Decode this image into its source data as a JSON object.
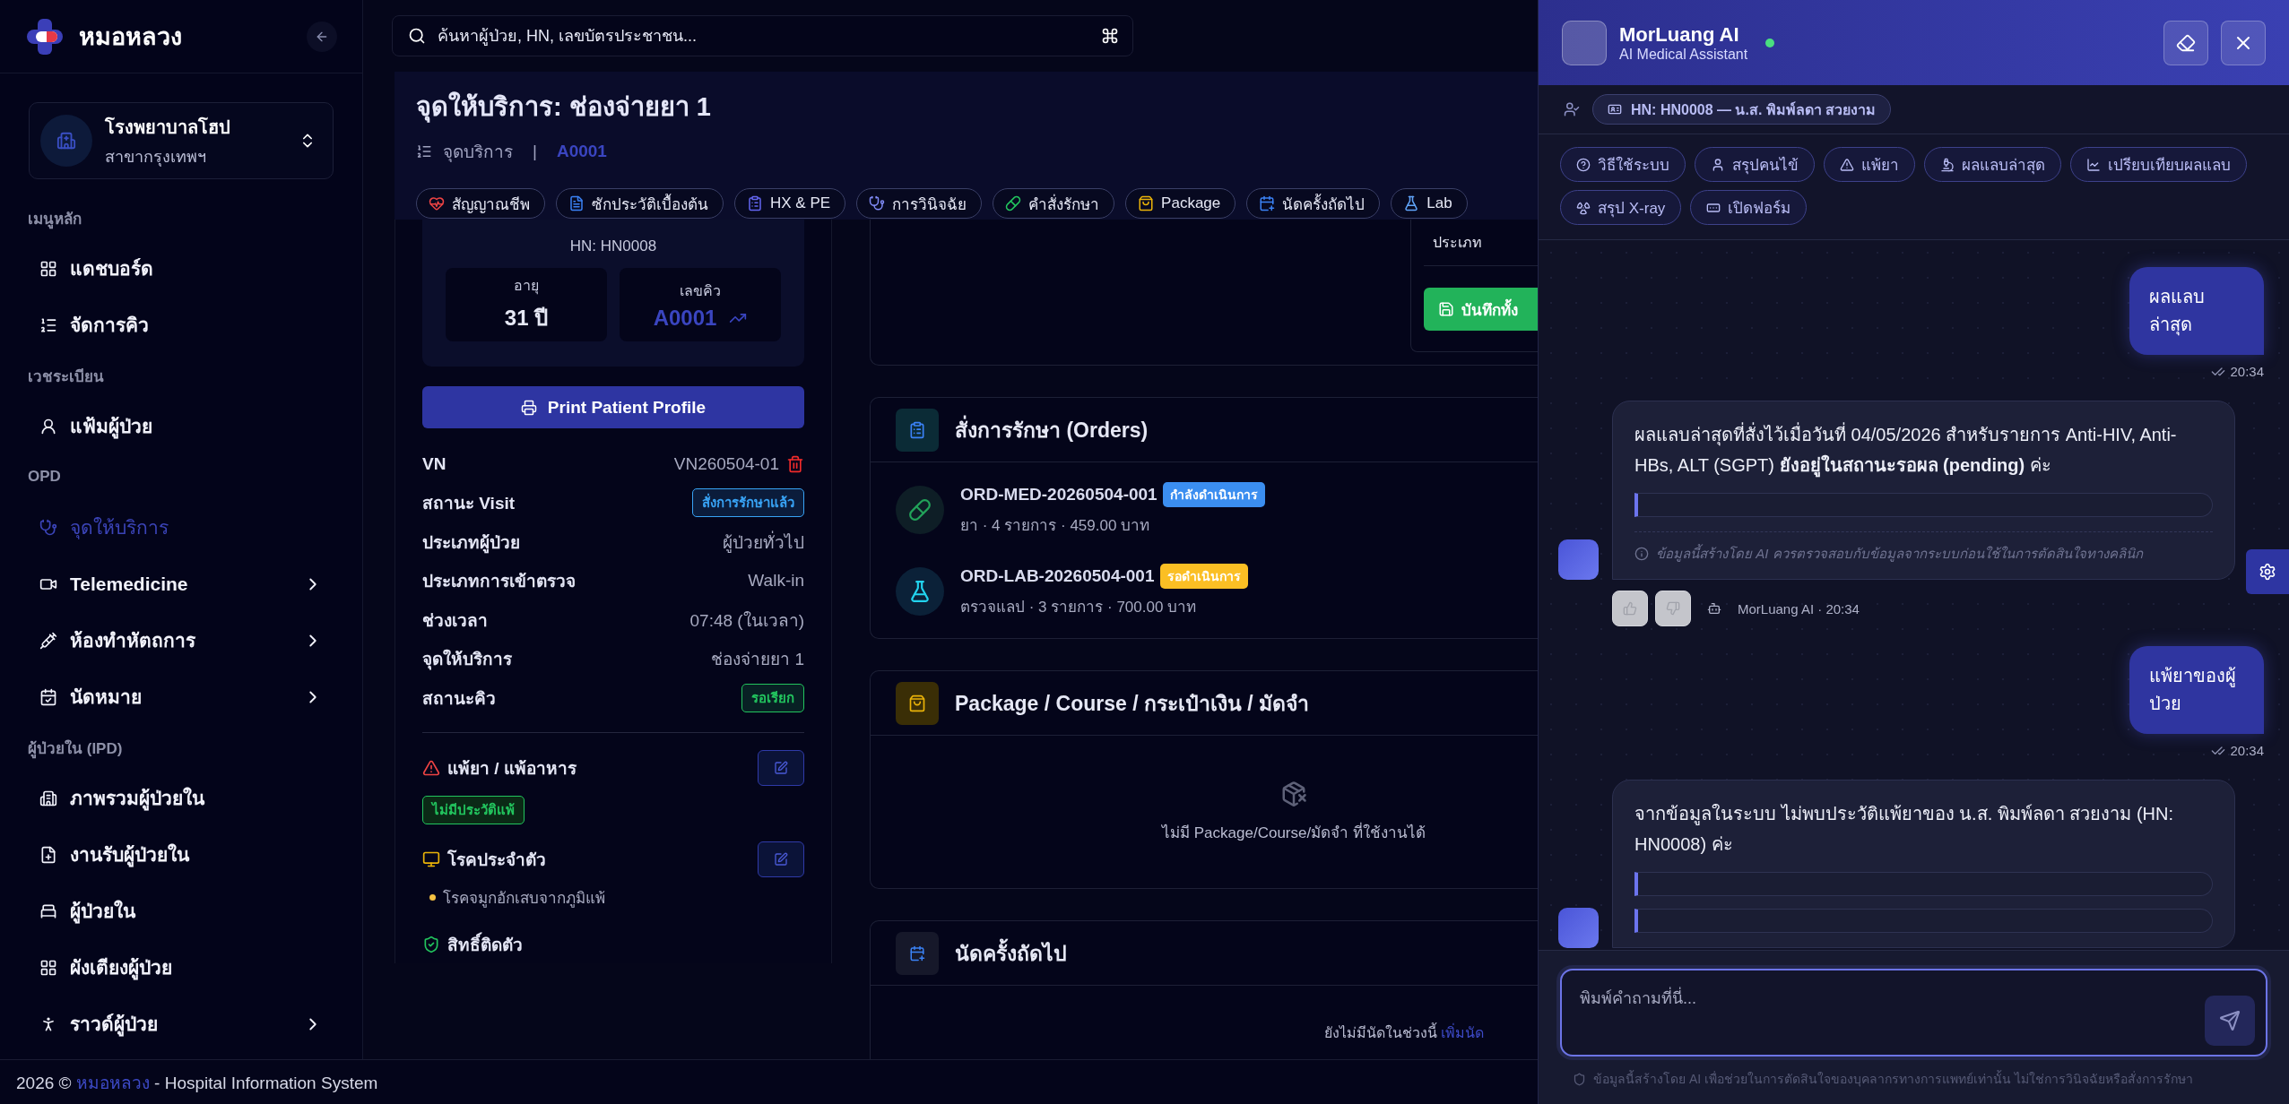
{
  "sidebar": {
    "brand": "หมอหลวง",
    "hospital": {
      "name": "โรงพยาบาลโฮป",
      "branch": "สาขากรุงเทพฯ"
    },
    "sections": [
      {
        "title": "เมนูหลัก",
        "items": [
          {
            "label": "แดชบอร์ด",
            "selected": false,
            "has_submenu": false
          },
          {
            "label": "จัดการคิว",
            "selected": false,
            "has_submenu": false
          }
        ]
      },
      {
        "title": "เวชระเบียน",
        "items": [
          {
            "label": "แฟ้มผู้ป่วย",
            "selected": false,
            "has_submenu": false
          }
        ]
      },
      {
        "title": "OPD",
        "items": [
          {
            "label": "จุดให้บริการ",
            "selected": true,
            "has_submenu": false
          },
          {
            "label": "Telemedicine",
            "selected": false,
            "has_submenu": true
          },
          {
            "label": "ห้องทำหัตถการ",
            "selected": false,
            "has_submenu": true
          },
          {
            "label": "นัดหมาย",
            "selected": false,
            "has_submenu": true
          }
        ]
      },
      {
        "title": "ผู้ป่วยใน (IPD)",
        "items": [
          {
            "label": "ภาพรวมผู้ป่วยใน",
            "selected": false,
            "has_submenu": false
          },
          {
            "label": "งานรับผู้ป่วยใน",
            "selected": false,
            "has_submenu": false
          },
          {
            "label": "ผู้ป่วยใน",
            "selected": false,
            "has_submenu": false
          },
          {
            "label": "ผังเตียงผู้ป่วย",
            "selected": false,
            "has_submenu": false
          },
          {
            "label": "ราวด์ผู้ป่วย",
            "selected": false,
            "has_submenu": true
          }
        ]
      }
    ]
  },
  "search": {
    "placeholder": "ค้นหาผู้ป่วย, HN, เลขบัตรประชาชน..."
  },
  "page_header": {
    "title": "จุดให้บริการ: ช่องจ่ายยา 1",
    "breadcrumb": "จุดบริการ",
    "separator": "|",
    "queue": "A0001",
    "tabs": [
      "สัญญาณชีพ",
      "ซักประวัติเบื้องต้น",
      "HX & PE",
      "การวินิจฉัย",
      "คำสั่งรักษา",
      "Package",
      "นัดครั้งถัดไป",
      "Lab"
    ]
  },
  "patient": {
    "hn": "HN: HN0008",
    "stats": [
      {
        "label": "อายุ",
        "value": "31 ปี",
        "highlight": false
      },
      {
        "label": "เลขคิว",
        "value": "A0001",
        "highlight": true
      }
    ],
    "print_button": "Print Patient Profile",
    "rows": [
      {
        "label": "VN",
        "value": "VN260504-01",
        "kind": "text",
        "deletable": true
      },
      {
        "label": "สถานะ Visit",
        "value": "สั่งการรักษาแล้ว",
        "kind": "badge",
        "color": "#38a3f5"
      },
      {
        "label": "ประเภทผู้ป่วย",
        "value": "ผู้ป่วยทั่วไป",
        "kind": "text",
        "deletable": false
      },
      {
        "label": "ประเภทการเข้าตรวจ",
        "value": "Walk-in",
        "kind": "text",
        "deletable": false
      },
      {
        "label": "ช่วงเวลา",
        "value": "07:48 (ในเวลา)",
        "kind": "text",
        "deletable": false
      },
      {
        "label": "จุดให้บริการ",
        "value": "ช่องจ่ายยา 1",
        "kind": "text",
        "deletable": false
      },
      {
        "label": "สถานะคิว",
        "value": "รอเรียก",
        "kind": "badge",
        "color": "#22c55e"
      }
    ],
    "allergy": {
      "title": "แพ้ยา / แพ้อาหาร",
      "badge": "ไม่มีประวัติแพ้"
    },
    "chronic": {
      "title": "โรคประจำตัว",
      "items": [
        "โรคจมูกอักเสบจากภูมิแพ้"
      ]
    },
    "rights": {
      "title": "สิทธิ์ติดตัว"
    }
  },
  "visit_panel": {
    "type_label": "ประเภท",
    "save_button": "บันทึกทั้ง"
  },
  "orders": {
    "title": "สั่งการรักษา (Orders)",
    "items": [
      {
        "kind": "med",
        "code": "ORD-MED-20260504-001",
        "status": "กำลังดำเนินการ",
        "color": "#3b8ef0",
        "detail": "ยา · 4 รายการ · 459.00 บาท"
      },
      {
        "kind": "lab",
        "code": "ORD-LAB-20260504-001",
        "status": "รอดำเนินการ",
        "color": "#fbbf24",
        "detail": "ตรวจแลป · 3 รายการ · 700.00 บาท"
      }
    ]
  },
  "package": {
    "title": "Package / Course / กระเป๋าเงิน / มัดจำ",
    "empty_text": "ไม่มี Package/Course/มัดจำ ที่ใช้งานได้"
  },
  "appointment": {
    "title": "นัดครั้งถัดไป",
    "empty_text": "ยังไม่มีนัดในช่วงนี้",
    "link": "เพิ่มนัด"
  },
  "footer": {
    "year": "2026 ©",
    "brand": "หมอหลวง",
    "rest": "- Hospital Information System"
  },
  "chat": {
    "title": "MorLuang AI",
    "subtitle": "AI Medical Assistant",
    "online": true,
    "context": "HN: HN0008 — น.ส. พิมพ์ลดา สวยงาม",
    "quick_actions": [
      "วิธีใช้ระบบ",
      "สรุปคนไข้",
      "แพ้ยา",
      "ผลแลบล่าสุด",
      "เปรียบเทียบผลแลบ",
      "สรุป X-ray",
      "เปิดฟอร์ม"
    ],
    "messages": [
      {
        "kind": "user",
        "text": "ผลแลบล่าสุด",
        "time": "20:34",
        "read": true
      },
      {
        "kind": "ai",
        "text": "ผลแลบล่าสุดที่สั่งไว้เมื่อวันที่ 04/05/2026 สำหรับรายการ Anti-HIV, Anti-HBs, ALT (SGPT) **ยังอยู่ในสถานะรอผล (pending)** ค่ะ",
        "cards": [
          {
            "kind": "placeholder"
          }
        ],
        "disclaimer": "ข้อมูลนี้สร้างโดย AI ควรตรวจสอบกับข้อมูลจากระบบก่อนใช้ในการตัดสินใจทางคลินิก",
        "meta": "MorLuang AI · 20:34"
      },
      {
        "kind": "user",
        "text": "แพ้ยาของผู้ป่วย",
        "time": "20:34",
        "read": true
      },
      {
        "kind": "ai",
        "text": "จากข้อมูลในระบบ ไม่พบประวัติแพ้ยาของ น.ส. พิมพ์ลดา สวยงาม (HN: HN0008) ค่ะ",
        "cards": [
          {
            "kind": "placeholder"
          },
          {
            "kind": "placeholder"
          }
        ]
      }
    ],
    "input_placeholder": "พิมพ์คำถามที่นี่...",
    "footnote": "ข้อมูลนี้สร้างโดย AI เพื่อช่วยในการตัดสินใจของบุคลากรทางการแพทย์เท่านั้น ไม่ใช่การวินิจฉัยหรือสั่งการรักษา"
  }
}
